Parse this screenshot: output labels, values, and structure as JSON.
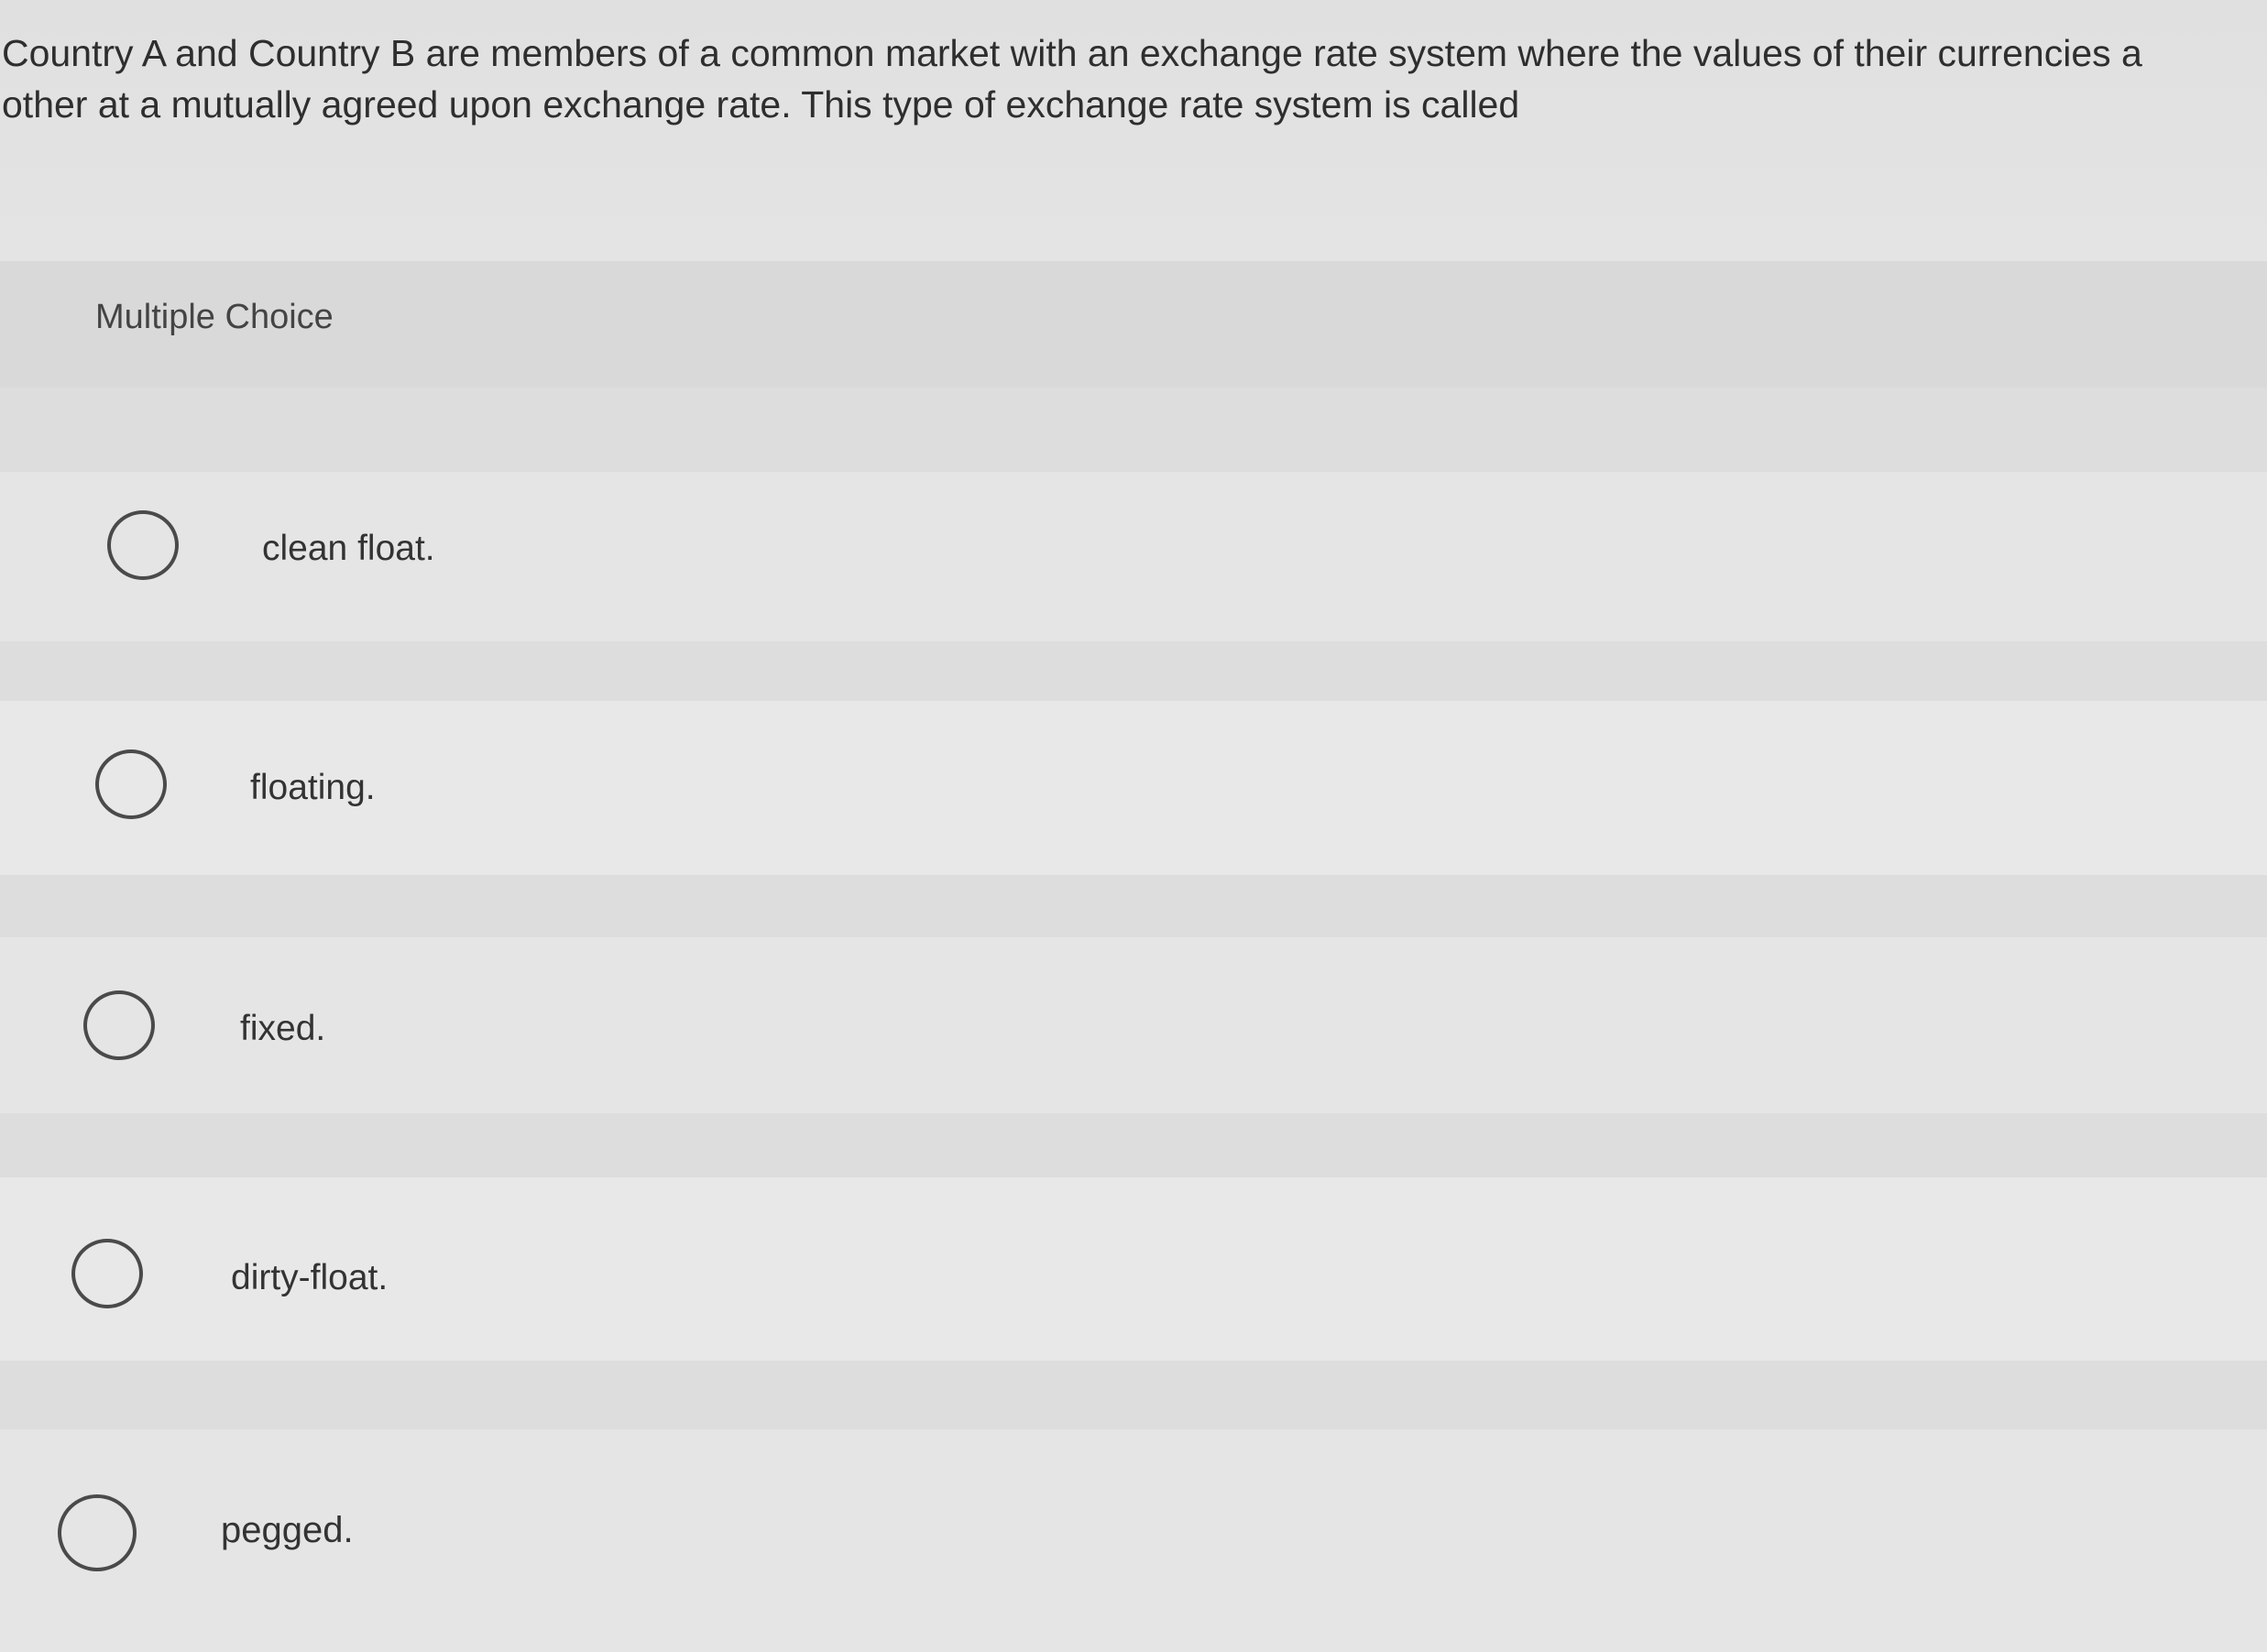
{
  "question": {
    "line1": "Country A and Country B are members of a common market with an exchange rate system where the values of their currencies a",
    "line2": "other at a mutually agreed upon exchange rate. This type of exchange rate system is called"
  },
  "multiple_choice": {
    "header": "Multiple Choice",
    "options": [
      {
        "label": "clean float.",
        "selected": false
      },
      {
        "label": "floating.",
        "selected": false
      },
      {
        "label": "fixed.",
        "selected": false
      },
      {
        "label": "dirty-float.",
        "selected": false
      },
      {
        "label": "pegged.",
        "selected": false
      }
    ]
  }
}
